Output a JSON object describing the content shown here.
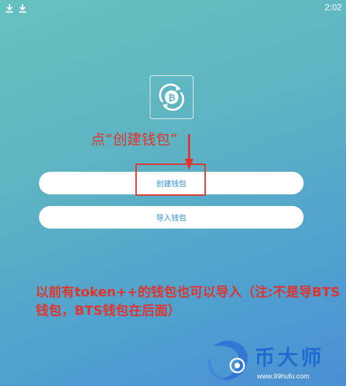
{
  "status_bar": {
    "time": "2:02",
    "left_icons": [
      "download-icon",
      "download-icon"
    ]
  },
  "app": {
    "logo_icon": "bitcoin-refresh-icon",
    "create_wallet_label": "创建钱包",
    "import_wallet_label": "导入钱包"
  },
  "annotations": {
    "top_hint": "点“创建钱包”",
    "bottom_note": "以前有token++的钱包也可以导入（注:不是导BTS钱包，BTS钱包在后面）",
    "highlight_color": "#e0342d"
  },
  "watermark": {
    "title": "币大师",
    "url": "www.99hufu.com"
  },
  "colors": {
    "gradient_start": "#67c2bd",
    "gradient_end": "#4b8fd4",
    "button_text": "#2d8fd8",
    "annotation": "#e0342d",
    "watermark_blue": "#1f6bd1"
  }
}
